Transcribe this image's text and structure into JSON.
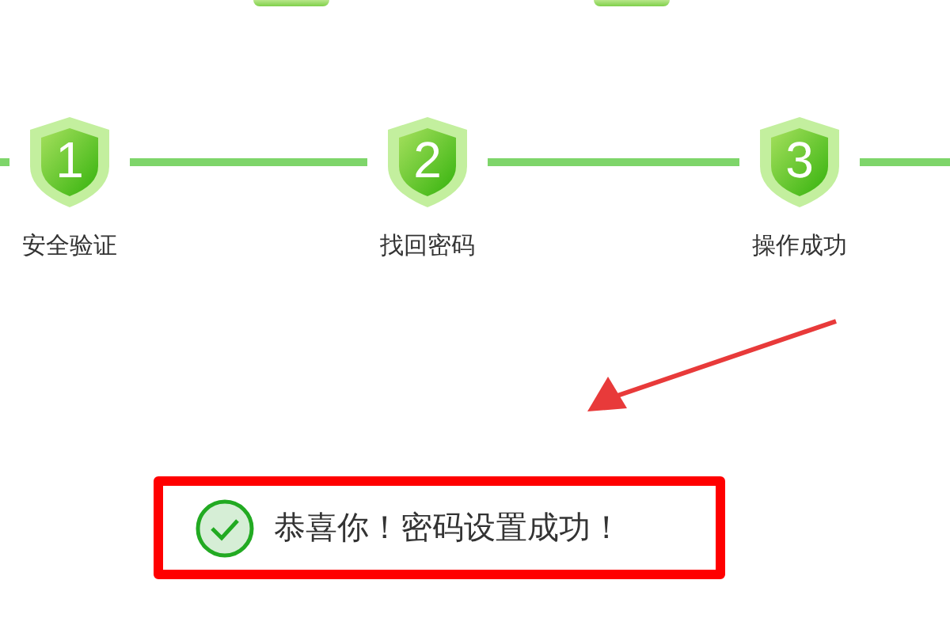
{
  "steps": [
    {
      "number": "1",
      "label": "安全验证"
    },
    {
      "number": "2",
      "label": "找回密码"
    },
    {
      "number": "3",
      "label": "操作成功"
    }
  ],
  "message": {
    "text": "恭喜你！密码设置成功！"
  }
}
